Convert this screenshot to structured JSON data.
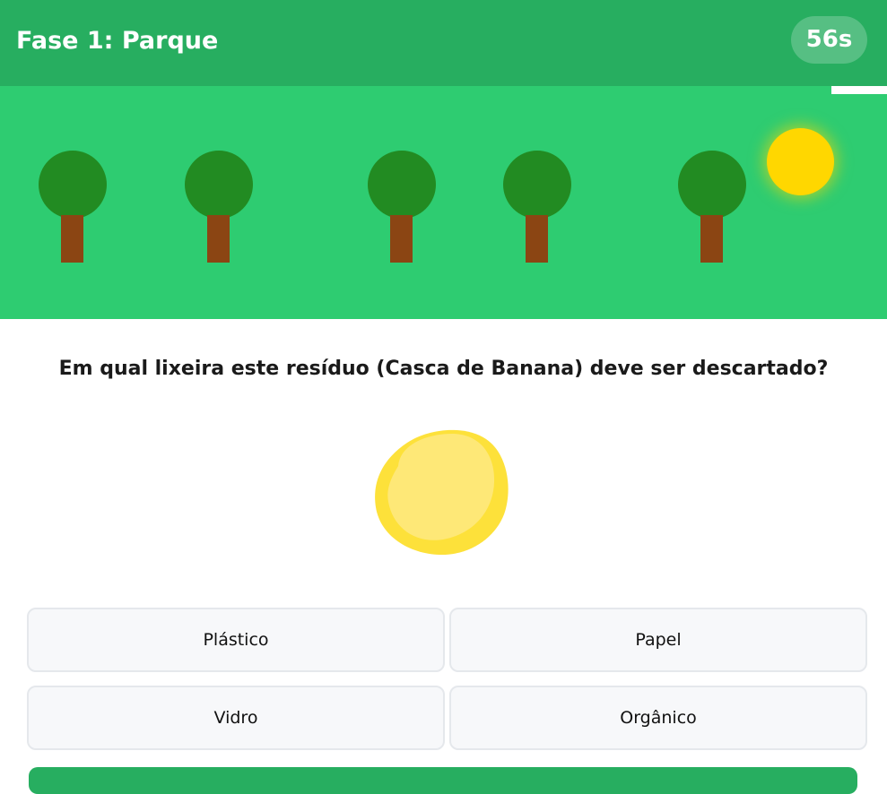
{
  "header": {
    "phase_title": "Fase 1: Parque",
    "timer": "56s"
  },
  "progress": {
    "fraction": 0.063
  },
  "scene": {
    "trees": 5,
    "sun": true,
    "colors": {
      "sky": "#2ecc71",
      "crown": "#228b22",
      "trunk": "#8b4513",
      "sun": "#ffd700"
    }
  },
  "question": {
    "text": "Em qual lixeira este resíduo (Casca de Banana) deve ser descartado?"
  },
  "item": {
    "icon": "banana-peel-icon"
  },
  "options": [
    {
      "label": "Plástico"
    },
    {
      "label": "Papel"
    },
    {
      "label": "Vidro"
    },
    {
      "label": "Orgânico"
    }
  ],
  "colors": {
    "header": "#27ae60",
    "accent": "#2ecc71",
    "option_bg": "#f7f8fa",
    "option_border": "#e5e8ec"
  }
}
